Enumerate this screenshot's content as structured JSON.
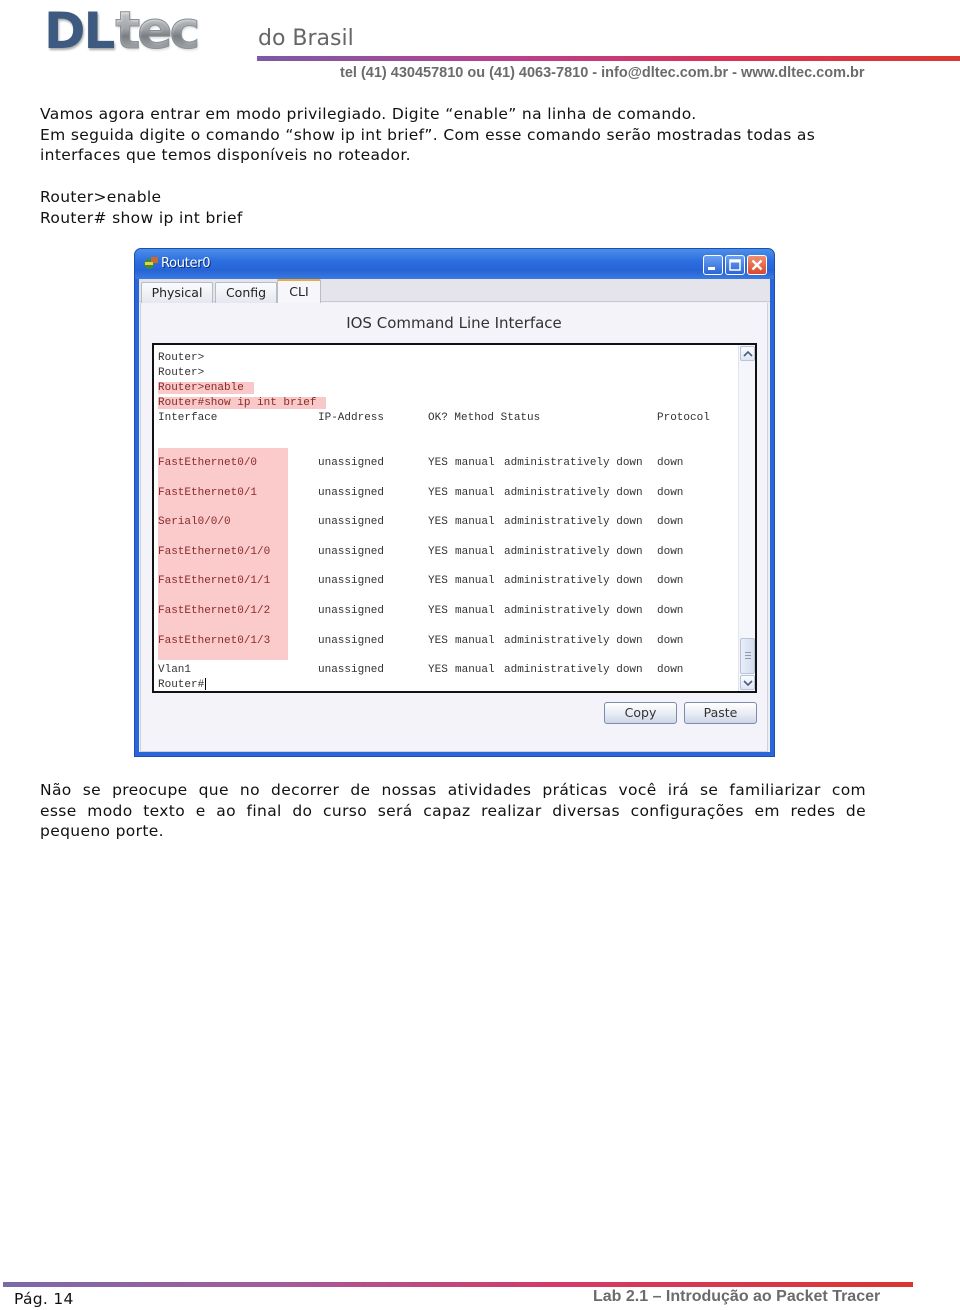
{
  "header": {
    "logo_primary": "DL",
    "logo_secondary": "tec",
    "logo_subtitle": "do Brasil",
    "contact": "tel (41) 430457810 ou (41) 4063-7810 - info@dltec.com.br - www.dltec.com.br",
    "bar_gradient": [
      "#7b5aa6",
      "#b7418f",
      "#d8325a",
      "#d9382e"
    ]
  },
  "intro": {
    "lines": [
      "Vamos agora entrar em modo privilegiado. Digite “enable” na linha de comando.",
      "Em seguida digite o comando “show ip int brief”. Com esse comando serão mostradas todas as",
      "interfaces que temos disponíveis no roteador."
    ]
  },
  "commands": {
    "lines": [
      "Router>enable",
      "Router# show ip int brief"
    ]
  },
  "window": {
    "title": "Router0",
    "tabs": [
      {
        "label": "Physical",
        "active": false
      },
      {
        "label": "Config",
        "active": false
      },
      {
        "label": "CLI",
        "active": true
      }
    ],
    "panel_title": "IOS Command Line Interface",
    "terminal": {
      "prompt_lines": [
        "Router>",
        "Router>",
        "Router>enable",
        "Router#show ip int brief"
      ],
      "header": {
        "interface": "Interface",
        "ip": "IP-Address",
        "status_cols": "OK? Method Status",
        "protocol": "Protocol"
      },
      "rows": [
        {
          "interface": "FastEthernet0/0",
          "ip": "unassigned",
          "ok": "YES",
          "method": "manual",
          "status": "administratively down",
          "protocol": "down"
        },
        {
          "interface": "FastEthernet0/1",
          "ip": "unassigned",
          "ok": "YES",
          "method": "manual",
          "status": "administratively down",
          "protocol": "down"
        },
        {
          "interface": "Serial0/0/0",
          "ip": "unassigned",
          "ok": "YES",
          "method": "manual",
          "status": "administratively down",
          "protocol": "down"
        },
        {
          "interface": "FastEthernet0/1/0",
          "ip": "unassigned",
          "ok": "YES",
          "method": "manual",
          "status": "administratively down",
          "protocol": "down"
        },
        {
          "interface": "FastEthernet0/1/1",
          "ip": "unassigned",
          "ok": "YES",
          "method": "manual",
          "status": "administratively down",
          "protocol": "down"
        },
        {
          "interface": "FastEthernet0/1/2",
          "ip": "unassigned",
          "ok": "YES",
          "method": "manual",
          "status": "administratively down",
          "protocol": "down"
        },
        {
          "interface": "FastEthernet0/1/3",
          "ip": "unassigned",
          "ok": "YES",
          "method": "manual",
          "status": "administratively down",
          "protocol": "down"
        },
        {
          "interface": "Vlan1",
          "ip": "unassigned",
          "ok": "YES",
          "method": "manual",
          "status": "administratively down",
          "protocol": "down"
        }
      ],
      "final_prompt": "Router#",
      "highlight_color": "#f9c8c8"
    },
    "buttons": {
      "copy": "Copy",
      "paste": "Paste"
    }
  },
  "closing": {
    "lines": [
      "Não se preocupe que no decorrer de nossas atividades práticas você irá se familiarizar com",
      "esse modo texto e ao final do curso será capaz realizar diversas configurações em redes de",
      "pequeno porte."
    ]
  },
  "footer": {
    "page": "Pág. 14",
    "title": "Lab 2.1 – Introdução ao Packet Tracer"
  }
}
